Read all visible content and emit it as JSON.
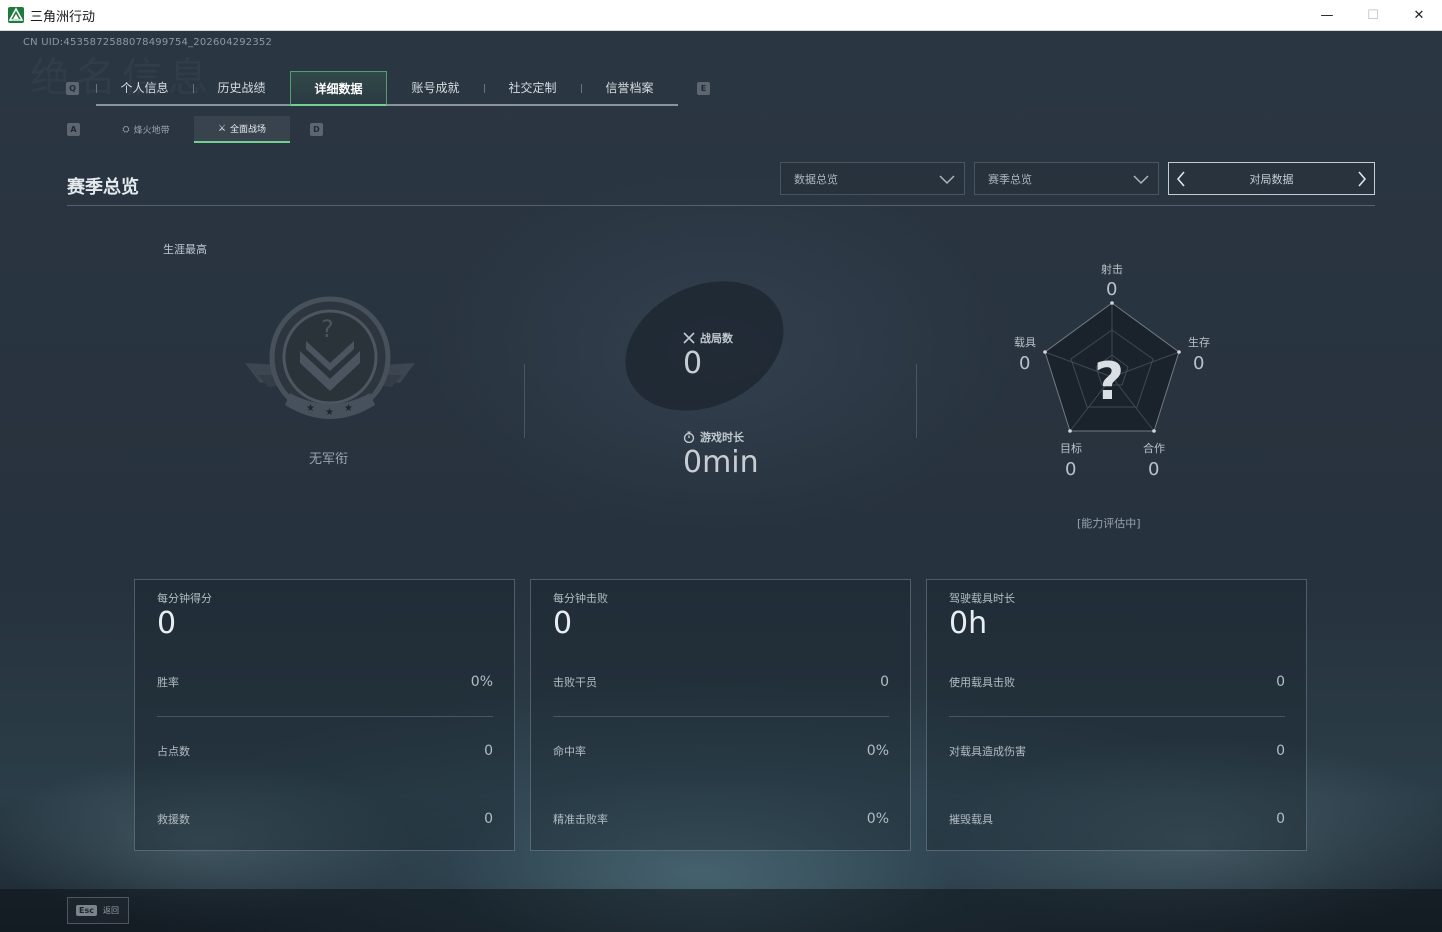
{
  "window": {
    "title": "三角洲行动",
    "min": "—",
    "max": "☐",
    "close": "✕"
  },
  "header": {
    "uid": "CN UID:4535872588078499754_202604292352",
    "ghost": "绝名信息",
    "key_left": "Q",
    "key_right": "E",
    "sub_key_left": "A",
    "sub_key_right": "D"
  },
  "tabs": [
    {
      "label": "个人信息"
    },
    {
      "label": "历史战绩"
    },
    {
      "label": "详细数据",
      "active": true
    },
    {
      "label": "账号成就"
    },
    {
      "label": "社交定制"
    },
    {
      "label": "信誉档案"
    }
  ],
  "subtabs": [
    {
      "label": "烽火地带",
      "icon": "⛭"
    },
    {
      "label": "全面战场",
      "icon": "⚔",
      "active": true
    }
  ],
  "section": {
    "title": "赛季总览",
    "dropdown1": "数据总览",
    "dropdown2": "赛季总览",
    "pager": "对局数据"
  },
  "rank": {
    "label": "生涯最高",
    "name": "无军衔",
    "badge_mark": "?"
  },
  "summary": {
    "matches_label": "战局数",
    "matches_value": "0",
    "time_label": "游戏时长",
    "time_value": "0min"
  },
  "radar": {
    "center_mark": "?",
    "status": "[能力评估中]",
    "axes": [
      {
        "label": "射击",
        "value": "0"
      },
      {
        "label": "生存",
        "value": "0"
      },
      {
        "label": "合作",
        "value": "0"
      },
      {
        "label": "目标",
        "value": "0"
      },
      {
        "label": "载具",
        "value": "0"
      }
    ]
  },
  "cards": [
    {
      "title": "每分钟得分",
      "big": "0",
      "rows": [
        {
          "label": "胜率",
          "value": "0%"
        },
        {
          "label": "占点数",
          "value": "0"
        },
        {
          "label": "救援数",
          "value": "0"
        }
      ]
    },
    {
      "title": "每分钟击败",
      "big": "0",
      "rows": [
        {
          "label": "击败干员",
          "value": "0"
        },
        {
          "label": "命中率",
          "value": "0%"
        },
        {
          "label": "精准击败率",
          "value": "0%"
        }
      ]
    },
    {
      "title": "驾驶载具时长",
      "big": "0h",
      "rows": [
        {
          "label": "使用载具击败",
          "value": "0"
        },
        {
          "label": "对载具造成伤害",
          "value": "0"
        },
        {
          "label": "摧毁载具",
          "value": "0"
        }
      ]
    }
  ],
  "footer": {
    "key": "Esc",
    "label": "返回"
  },
  "colors": {
    "accent": "#6fd28e",
    "bg": "#26323d"
  }
}
